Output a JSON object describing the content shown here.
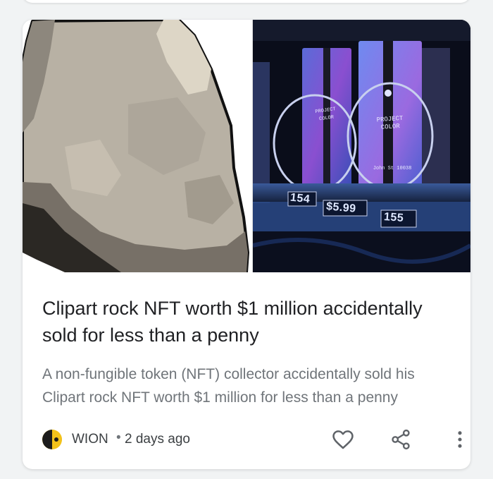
{
  "article": {
    "headline": "Clipart rock NFT worth $1 million accidentally sold for less than a penny",
    "snippet": "A non-fungible token (NFT) collector accidentally sold his Clipart rock NFT worth $1 million for less than a penny",
    "source": "WION",
    "separator": "•",
    "time": "2 days ago"
  },
  "hero_image": {
    "left_panel": "clipart-rock",
    "right_panel": {
      "package_label": "PROJECT COLOR",
      "package_address": "John St 10038",
      "price_tags": [
        "154",
        "$5.99",
        "155"
      ]
    }
  },
  "actions": {
    "favorite_icon": "heart-outline-icon",
    "share_icon": "share-icon",
    "more_icon": "more-vert-icon"
  },
  "colors": {
    "page_background": "#f1f3f4",
    "card_background": "#ffffff",
    "headline": "#202124",
    "snippet": "#70757a",
    "icon": "#5f6368",
    "source_logo": "#f2c21b"
  }
}
